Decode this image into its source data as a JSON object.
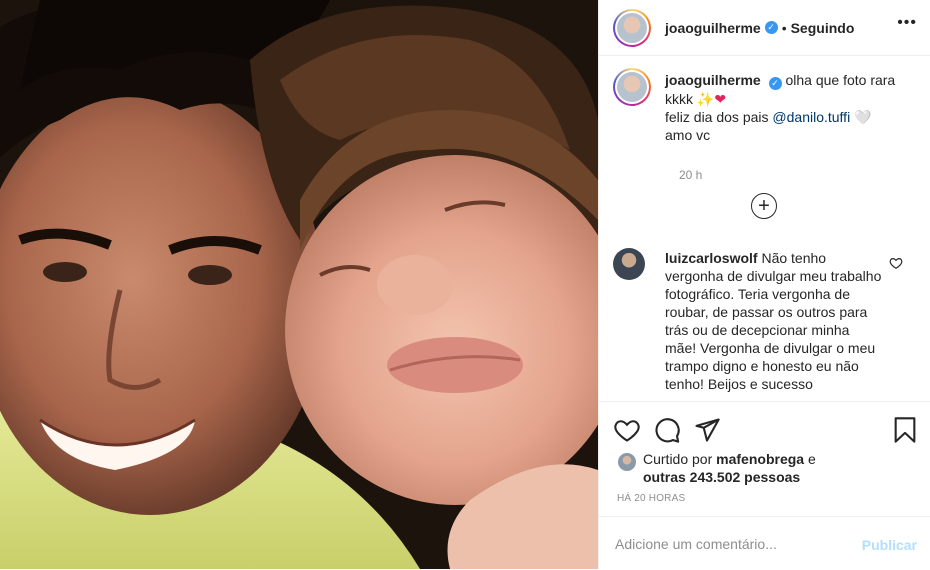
{
  "post": {
    "photo_alt": "",
    "header": {
      "username": "joaoguilherme",
      "separator": "•",
      "follow_status": "Seguindo",
      "more_icon": "more-horizontal-icon"
    },
    "caption": {
      "username": "joaoguilherme",
      "line1": "olha que foto rara kkkk",
      "emoji1": "✨",
      "emoji2": "❤",
      "line2_prefix": "feliz dia dos pais",
      "mention": "@danilo.tuffi",
      "emoji3": "🤍",
      "line3": "amo vc",
      "time": "20 h"
    },
    "load_more_icon": "plus-circle-icon",
    "comment": {
      "username": "luizcarloswolf",
      "text": "Não tenho vergonha de divulgar meu trabalho fotográfico. Teria vergonha de roubar, de passar os outros para trás ou de decepcionar minha mãe! Vergonha de divulgar o meu trampo digno e honesto eu não tenho! Beijos e sucesso"
    },
    "actions": {
      "like_icon": "heart-icon",
      "comment_icon": "comment-icon",
      "share_icon": "share-icon",
      "save_icon": "bookmark-icon"
    },
    "likes": {
      "prefix": "Curtido por",
      "user": "mafenobrega",
      "middle": "e",
      "others": "outras 243.502 pessoas"
    },
    "timestamp": "HÁ 20 HORAS",
    "add_comment": {
      "placeholder": "Adicione um comentário...",
      "publish_label": "Publicar"
    },
    "colors": {
      "verified": "#3897f0",
      "link": "#00376b",
      "publish_disabled": "#b2dffc",
      "muted": "#8e8e8e",
      "border": "#efefef"
    }
  }
}
